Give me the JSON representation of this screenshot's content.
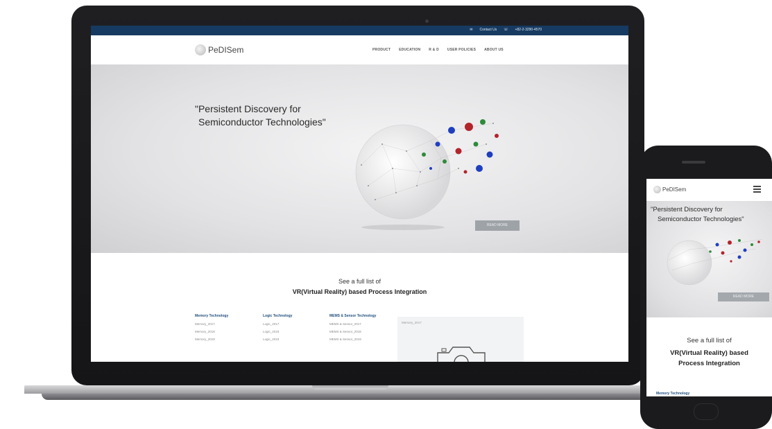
{
  "site": {
    "logo_text": "PeDISem",
    "topbar": {
      "contact": "Contact Us",
      "phone": "+82-2-3290-4570"
    },
    "nav": [
      "PRODUCT",
      "EDUCATION",
      "R & D",
      "USER POLICIES",
      "ABOUT US"
    ],
    "hero": {
      "quote_line1": "\"Persistent Discovery for",
      "quote_line2": "Semiconductor Technologies\"",
      "button": "READ MORE"
    },
    "section": {
      "line1": "See a full list of",
      "line2": "VR(Virtual Reality) based Process Integration",
      "columns": [
        {
          "title": "Memory Technology",
          "items": [
            "Memory_2017",
            "Memory_2018",
            "Memory_2019"
          ]
        },
        {
          "title": "Logic Technology",
          "items": [
            "Logic_2017",
            "Logic_2018",
            "Logic_2019"
          ]
        },
        {
          "title": "MEMS & Sensor Technology",
          "items": [
            "MEMS & Sensor_2017",
            "MEMS & Sensor_2018",
            "MEMS & Sensor_2019"
          ]
        }
      ],
      "image_label": "Memory_2017"
    }
  },
  "mobile": {
    "logo_text": "PeDISem",
    "quote_line1": "\"Persistent Discovery for",
    "quote_line2": "Semiconductor Technologies\"",
    "button": "READ MORE",
    "see_line1": "See a full list of",
    "see_line2": "VR(Virtual Reality) based",
    "see_line3": "Process Integration",
    "cut_heading": "Memory Technology"
  },
  "colors": {
    "topbar": "#163a62",
    "accent_blue": "#1f4e7d",
    "button_grey": "#9ea3a8",
    "dot_red": "#b3242b",
    "dot_green": "#2e8b3a",
    "dot_blue": "#1f3fbf"
  },
  "icons": [
    "envelope-icon",
    "phone-icon",
    "menu-icon",
    "camera-icon"
  ]
}
